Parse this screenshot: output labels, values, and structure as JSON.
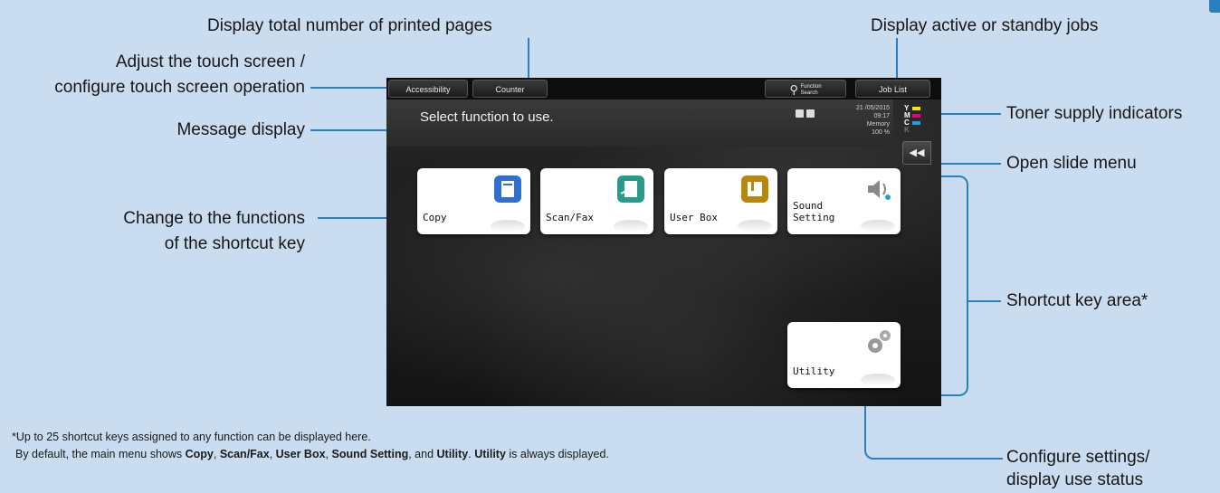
{
  "callouts": {
    "top_center": "Display total number of printed pages",
    "top_right": "Display active or standby jobs",
    "left_1_line1": "Adjust the touch screen /",
    "left_1_line2": "configure touch screen operation",
    "left_2": "Message display",
    "left_3_line1": "Change to the functions",
    "left_3_line2": "of the shortcut key",
    "right_1": "Toner supply indicators",
    "right_2": "Open slide menu",
    "right_3": "Shortcut key area*",
    "right_4_line1": "Configure settings/",
    "right_4_line2": "display use status"
  },
  "screen": {
    "accessibility_label": "Accessibility",
    "counter_label": "Counter",
    "function_search_line1": "Function",
    "function_search_line2": "Search",
    "job_list_label": "Job List",
    "message": "Select function to use.",
    "date": "21 /05/2015",
    "time": "09:17",
    "memory_label": "Memory",
    "memory_value": "100 %",
    "toner": [
      {
        "letter": "Y",
        "color": "#f2e600"
      },
      {
        "letter": "M",
        "color": "#e6007e"
      },
      {
        "letter": "C",
        "color": "#1e9fe0"
      },
      {
        "letter": "K",
        "color": "#111111"
      }
    ],
    "slide_menu_icon": "double-left-arrow-icon",
    "tiles": {
      "copy": "Copy",
      "scan_fax": "Scan/Fax",
      "user_box": "User Box",
      "sound_line1": "Sound",
      "sound_line2": "Setting",
      "utility": "Utility"
    }
  },
  "footnote": {
    "line1": "*Up to 25 shortcut keys assigned to any function can be displayed here.",
    "line2_prefix": "By default, the main menu shows ",
    "copy": "Copy",
    "sep1": ", ",
    "scan_fax": "Scan/Fax",
    "sep2": ", ",
    "user_box": "User Box",
    "sep3": ", ",
    "sound_setting": "Sound Setting",
    "sep4": ", and ",
    "utility": "Utility",
    "sep5": ". ",
    "utility2": "Utility",
    "suffix": " is always displayed."
  },
  "colors": {
    "accent": "#2a7fc0",
    "background": "#c9dcf0"
  }
}
